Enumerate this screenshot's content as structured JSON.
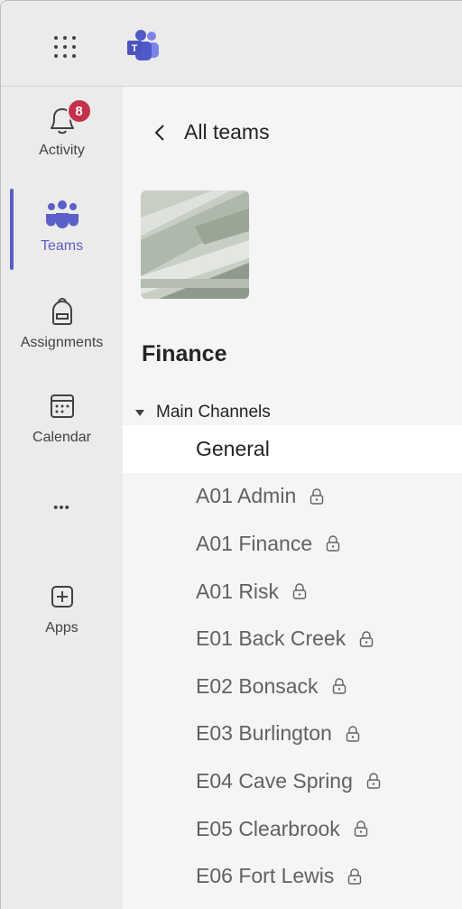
{
  "rail": {
    "activity": {
      "label": "Activity",
      "badge": "8"
    },
    "teams": {
      "label": "Teams"
    },
    "assignments": {
      "label": "Assignments"
    },
    "calendar": {
      "label": "Calendar"
    },
    "more": {
      "label": "•••"
    },
    "apps": {
      "label": "Apps"
    }
  },
  "panel": {
    "back_label": "All teams",
    "team_name": "Finance",
    "section_label": "Main Channels",
    "channels": [
      {
        "name": "General",
        "locked": false,
        "selected": true
      },
      {
        "name": "A01 Admin",
        "locked": true
      },
      {
        "name": "A01 Finance",
        "locked": true
      },
      {
        "name": "A01 Risk",
        "locked": true
      },
      {
        "name": "E01 Back Creek",
        "locked": true
      },
      {
        "name": "E02 Bonsack",
        "locked": true
      },
      {
        "name": "E03 Burlington",
        "locked": true
      },
      {
        "name": "E04 Cave Spring",
        "locked": true
      },
      {
        "name": "E05 Clearbrook",
        "locked": true
      },
      {
        "name": "E06 Fort Lewis",
        "locked": true
      }
    ]
  },
  "colors": {
    "accent": "#5b5fc7",
    "badge": "#c4314b",
    "selected_row": "#ffffff"
  }
}
